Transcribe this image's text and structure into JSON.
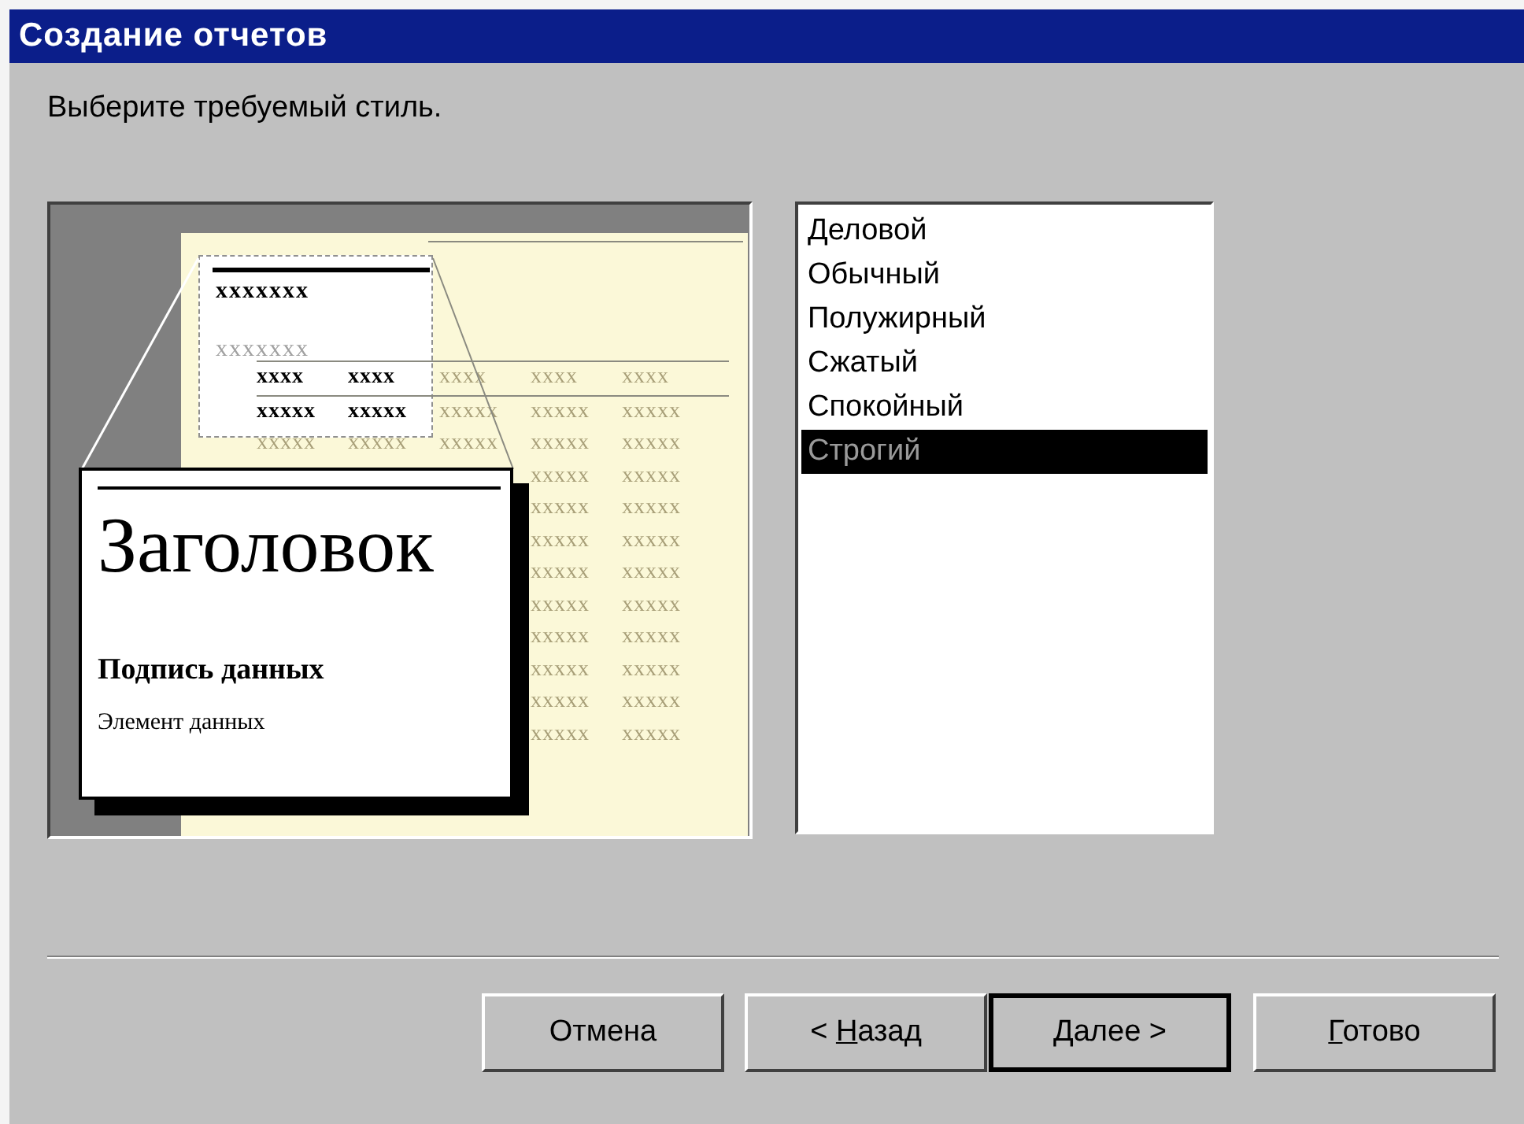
{
  "window": {
    "title": "Создание отчетов"
  },
  "instruction": "Выберите требуемый стиль.",
  "preview": {
    "heading": "xxxxxxx",
    "group": "xxxxxxx",
    "rows": [
      {
        "kind": "header",
        "cells": [
          {
            "text": "xxxx",
            "zoomed": true
          },
          {
            "text": "xxxx",
            "zoomed": true
          },
          {
            "text": "xxxx",
            "zoomed": false
          },
          {
            "text": "xxxx",
            "zoomed": false
          },
          {
            "text": "xxxx",
            "zoomed": false
          }
        ]
      },
      {
        "kind": "data",
        "cells": [
          {
            "text": "xxxxx",
            "zoomed": true
          },
          {
            "text": "xxxxx",
            "zoomed": true
          },
          {
            "text": "xxxxx",
            "zoomed": false
          },
          {
            "text": "xxxxx",
            "zoomed": false
          },
          {
            "text": "xxxxx",
            "zoomed": false
          }
        ]
      },
      {
        "kind": "data",
        "cells": [
          {
            "text": "xxxxx",
            "zoomed": false
          },
          {
            "text": "xxxxx",
            "zoomed": false
          },
          {
            "text": "xxxxx",
            "zoomed": false
          },
          {
            "text": "xxxxx",
            "zoomed": false
          },
          {
            "text": "xxxxx",
            "zoomed": false
          }
        ]
      },
      {
        "kind": "data",
        "cells": [
          {
            "text": "xxxxx",
            "zoomed": false
          },
          {
            "text": "xxxxx",
            "zoomed": false
          }
        ]
      },
      {
        "kind": "data",
        "cells": [
          {
            "text": "xxxxx",
            "zoomed": false
          },
          {
            "text": "xxxxx",
            "zoomed": false
          }
        ]
      },
      {
        "kind": "data",
        "cells": [
          {
            "text": "xxxxx",
            "zoomed": false
          },
          {
            "text": "xxxxx",
            "zoomed": false
          }
        ]
      },
      {
        "kind": "data",
        "cells": [
          {
            "text": "xxxxx",
            "zoomed": false
          },
          {
            "text": "xxxxx",
            "zoomed": false
          }
        ]
      },
      {
        "kind": "data",
        "cells": [
          {
            "text": "xxxxx",
            "zoomed": false
          },
          {
            "text": "xxxxx",
            "zoomed": false
          }
        ]
      },
      {
        "kind": "data",
        "cells": [
          {
            "text": "xxxxx",
            "zoomed": false
          },
          {
            "text": "xxxxx",
            "zoomed": false
          }
        ]
      },
      {
        "kind": "data",
        "cells": [
          {
            "text": "xxxxx",
            "zoomed": false
          },
          {
            "text": "xxxxx",
            "zoomed": false
          }
        ]
      },
      {
        "kind": "data",
        "cells": [
          {
            "text": "xxxxx",
            "zoomed": false
          },
          {
            "text": "xxxxx",
            "zoomed": false
          }
        ]
      },
      {
        "kind": "data",
        "cells": [
          {
            "text": "xxxxx",
            "zoomed": false
          },
          {
            "text": "xxxxx",
            "zoomed": false
          }
        ]
      }
    ],
    "card": {
      "title": "Заголовок",
      "label": "Подпись данных",
      "item": "Элемент данных"
    }
  },
  "styles": [
    {
      "label": "Деловой",
      "selected": false
    },
    {
      "label": "Обычный",
      "selected": false
    },
    {
      "label": "Полужирный",
      "selected": false
    },
    {
      "label": "Сжатый",
      "selected": false
    },
    {
      "label": "Спокойный",
      "selected": false
    },
    {
      "label": "Строгий",
      "selected": true
    }
  ],
  "buttons": [
    {
      "prefix": "Отмена",
      "default": false
    },
    {
      "prefix": "< ",
      "key": "Н",
      "rest": "азад",
      "default": false
    },
    {
      "key": "Д",
      "rest": "алее >",
      "default": true
    },
    {
      "key": "Г",
      "rest": "отово",
      "default": false
    }
  ]
}
